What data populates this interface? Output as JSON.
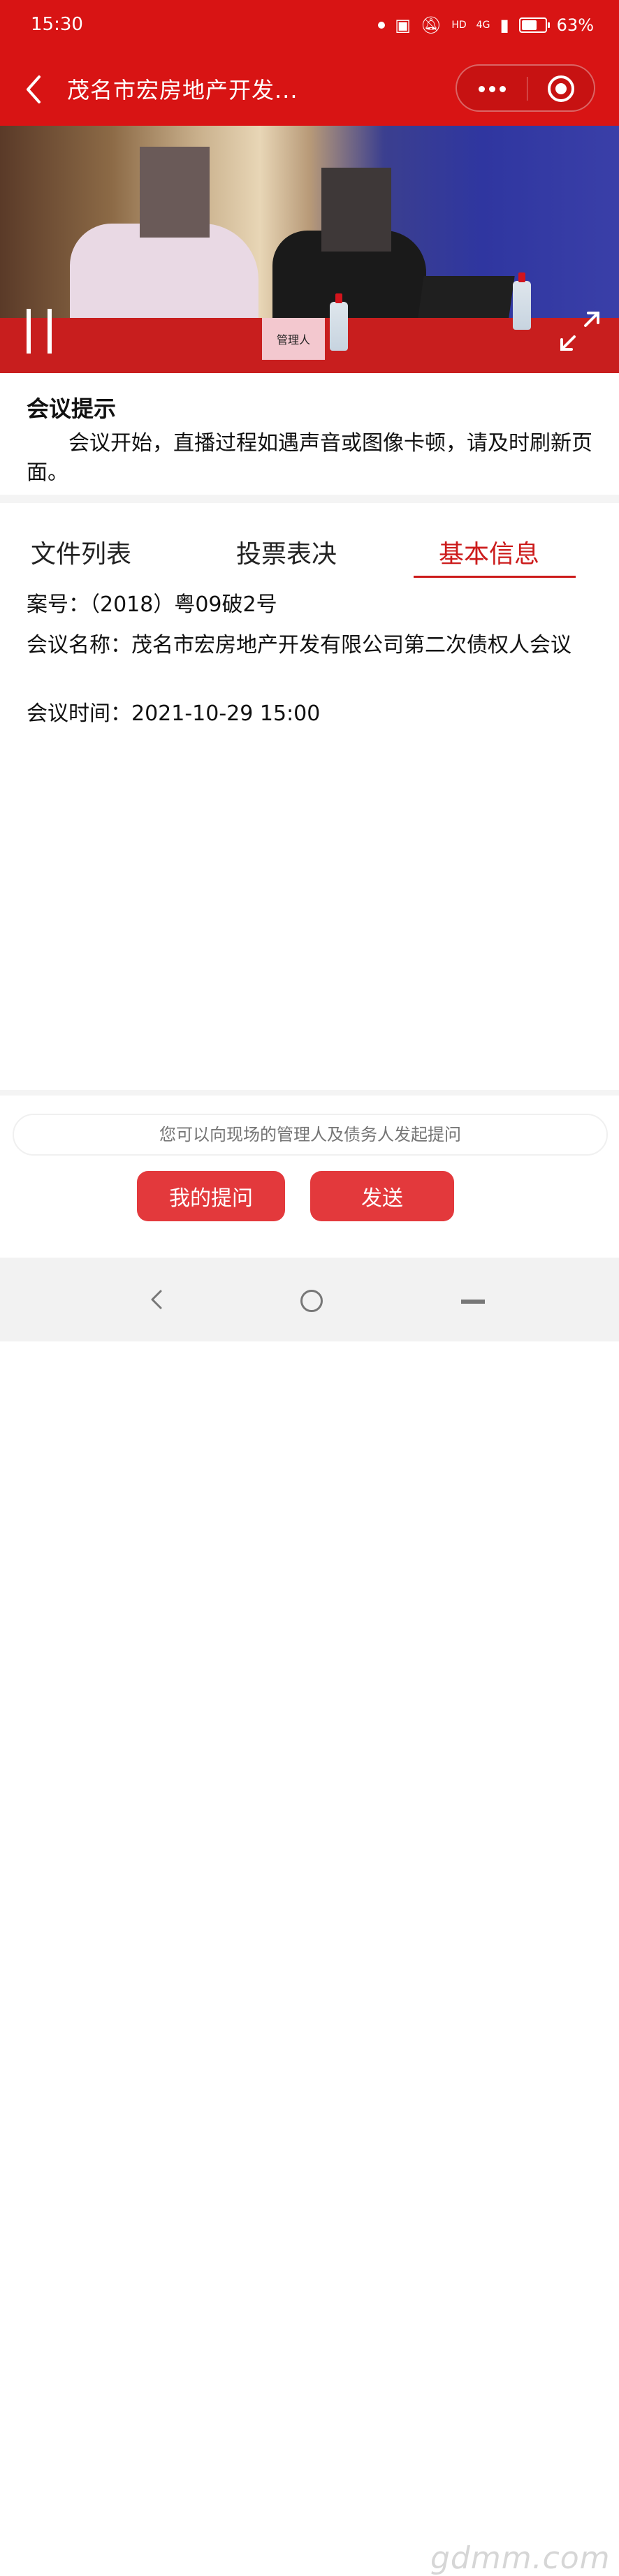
{
  "status_bar": {
    "time": "15:30",
    "battery": "63%",
    "network": "4G",
    "hd": "HD"
  },
  "nav": {
    "title": "茂名市宏房地产开发..."
  },
  "video": {
    "nameplate": "管理人"
  },
  "notice": {
    "title": "会议提示",
    "text": "会议开始，直播过程如遇声音或图像卡顿，请及时刷新页面。"
  },
  "tabs": [
    {
      "label": "文件列表"
    },
    {
      "label": "投票表决"
    },
    {
      "label": "基本信息",
      "active": true
    }
  ],
  "info": {
    "case_no": "案号：（2018）粤09破2号",
    "meeting_name": "会议名称：茂名市宏房地产开发有限公司第二次债权人会议",
    "meeting_time": "会议时间：2021-10-29 15:00"
  },
  "question": {
    "placeholder": "您可以向现场的管理人及债务人发起提问",
    "my_questions_label": "我的提问",
    "send_label": "发送"
  },
  "watermark": "gdmm.com",
  "colors": {
    "primary_red": "#d81414",
    "button_red": "#e3393c",
    "tab_active": "#cc1b1b"
  }
}
